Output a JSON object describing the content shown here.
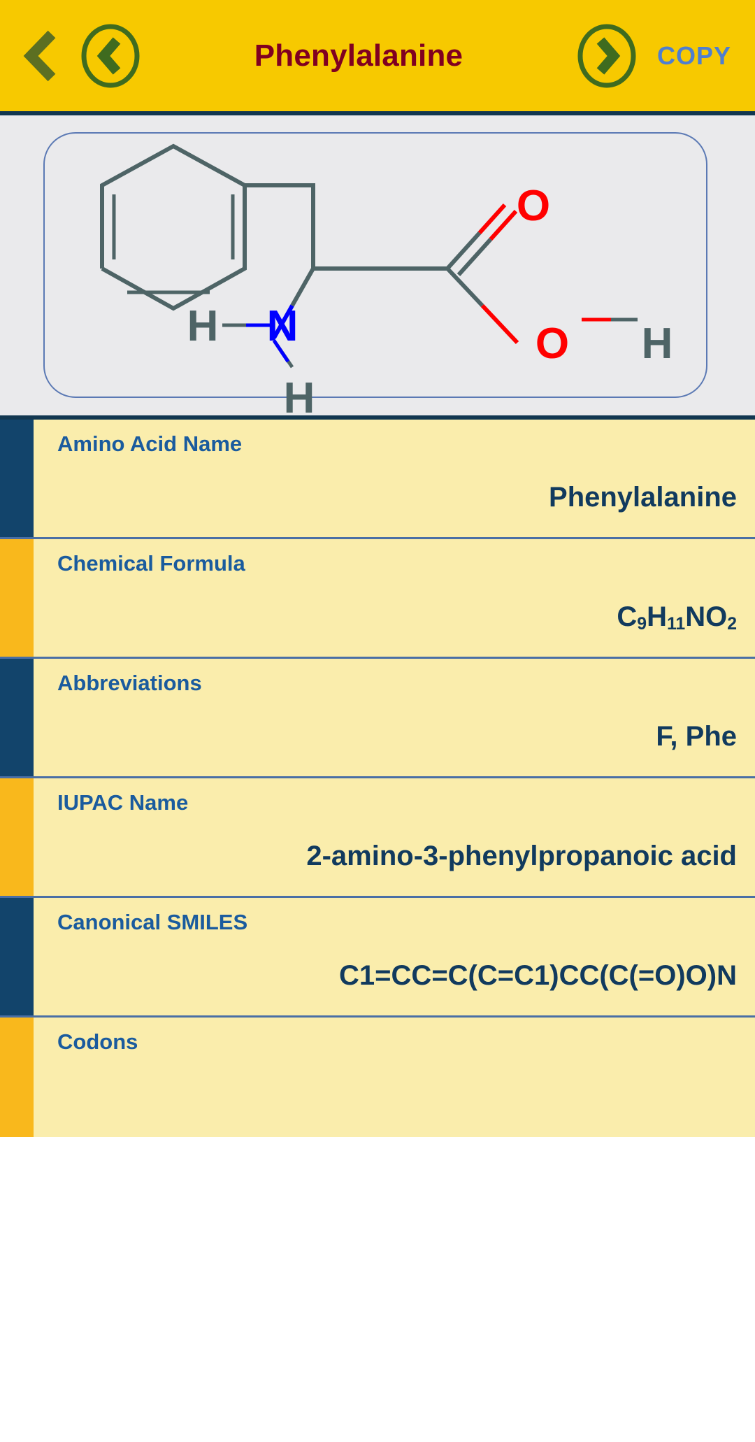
{
  "header": {
    "back_icon": "chevron-left-icon",
    "prev_button_icon": "circled-chevron-left-icon",
    "next_button_icon": "circled-chevron-right-icon",
    "title": "Phenylalanine",
    "copy_label": "COPY",
    "colors": {
      "background": "#f7c900",
      "title_text": "#800020",
      "copy_text": "#4f7fcf",
      "icon": "#3f6b1f",
      "divider": "#123750"
    }
  },
  "structure": {
    "panel_background": "#eaeaec",
    "card_border_color": "#5b79b4",
    "bond_color": "#4e6466",
    "oxygen_color": "#ff0000",
    "nitrogen_color": "#0000ff",
    "atom_labels": [
      {
        "text": "O",
        "role": "carbonyl-oxygen"
      },
      {
        "text": "O",
        "role": "hydroxyl-oxygen"
      },
      {
        "text": "H",
        "role": "hydroxyl-hydrogen"
      },
      {
        "text": "N",
        "role": "amine-nitrogen"
      },
      {
        "text": "H",
        "role": "amine-hydrogen-left"
      },
      {
        "text": "H",
        "role": "amine-hydrogen-bottom"
      }
    ]
  },
  "table": {
    "rows": [
      {
        "label": "Amino Acid Name",
        "value": "Phenylalanine",
        "accent": "navy"
      },
      {
        "label": "Chemical Formula",
        "value": "C9H11NO2",
        "accent": "gold",
        "formula_parts": [
          {
            "t": "C",
            "sub": false
          },
          {
            "t": "9",
            "sub": true
          },
          {
            "t": "H",
            "sub": false
          },
          {
            "t": "11",
            "sub": true
          },
          {
            "t": "NO",
            "sub": false
          },
          {
            "t": "2",
            "sub": true
          }
        ]
      },
      {
        "label": "Abbreviations",
        "value": "F, Phe",
        "accent": "navy"
      },
      {
        "label": "IUPAC Name",
        "value": "2-amino-3-phenylpropanoic acid",
        "accent": "gold"
      },
      {
        "label": "Canonical SMILES",
        "value": "C1=CC=C(C=C1)CC(C(=O)O)N",
        "accent": "navy"
      },
      {
        "label": "Codons",
        "value": "",
        "accent": "gold"
      }
    ],
    "colors": {
      "background": "#faedac",
      "label_text": "#1a5b9e",
      "value_text": "#113a5e",
      "divider": "#4a6fa5",
      "accent_navy": "#12446b",
      "accent_gold": "#f9b81c"
    }
  }
}
